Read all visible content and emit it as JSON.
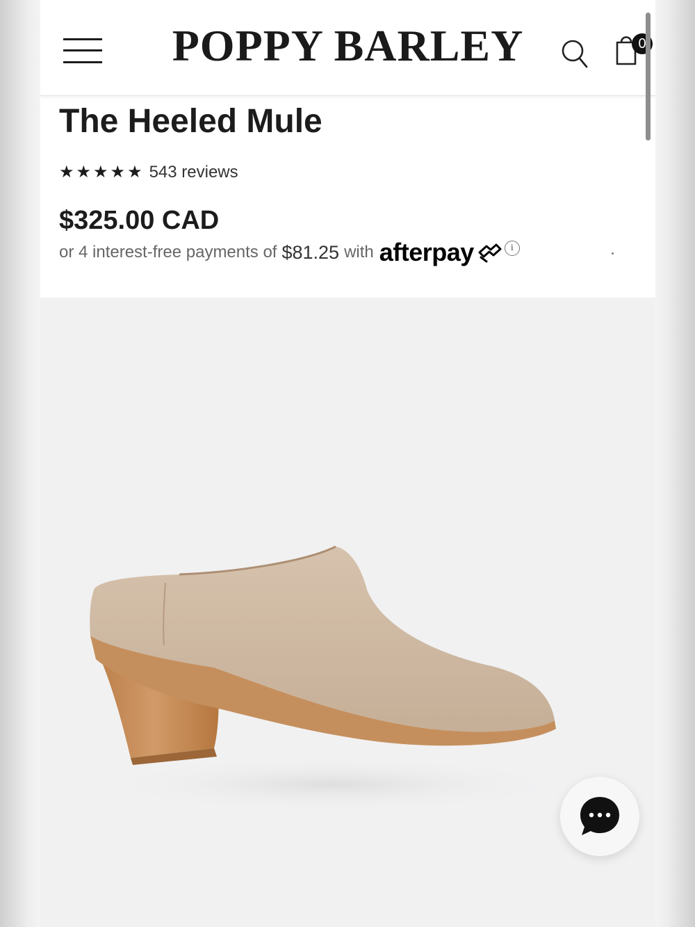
{
  "header": {
    "brand": "POPPY BARLEY",
    "cart_count": "0",
    "icons": [
      "menu-icon",
      "search-icon",
      "shopping-bag-icon"
    ]
  },
  "product": {
    "title": "The Heeled Mule",
    "rating": {
      "stars": 5,
      "reviews_label": "543 reviews"
    },
    "price": "$325.00 CAD",
    "afterpay": {
      "prefix": "or 4 interest-free payments of",
      "amount": "$81.25",
      "suffix": "with",
      "brand": "afterpay",
      "info_glyph": "i"
    },
    "image": {
      "subject": "beige leather heeled mule with stacked wood heel",
      "upper_color": "#cdb8a2",
      "heel_color": "#c58f5d"
    }
  },
  "chat": {
    "icon": "chat-bubble-icon"
  },
  "colors": {
    "text": "#1c1c1c",
    "muted": "#666666",
    "page_bg": "#f1f1f2"
  }
}
